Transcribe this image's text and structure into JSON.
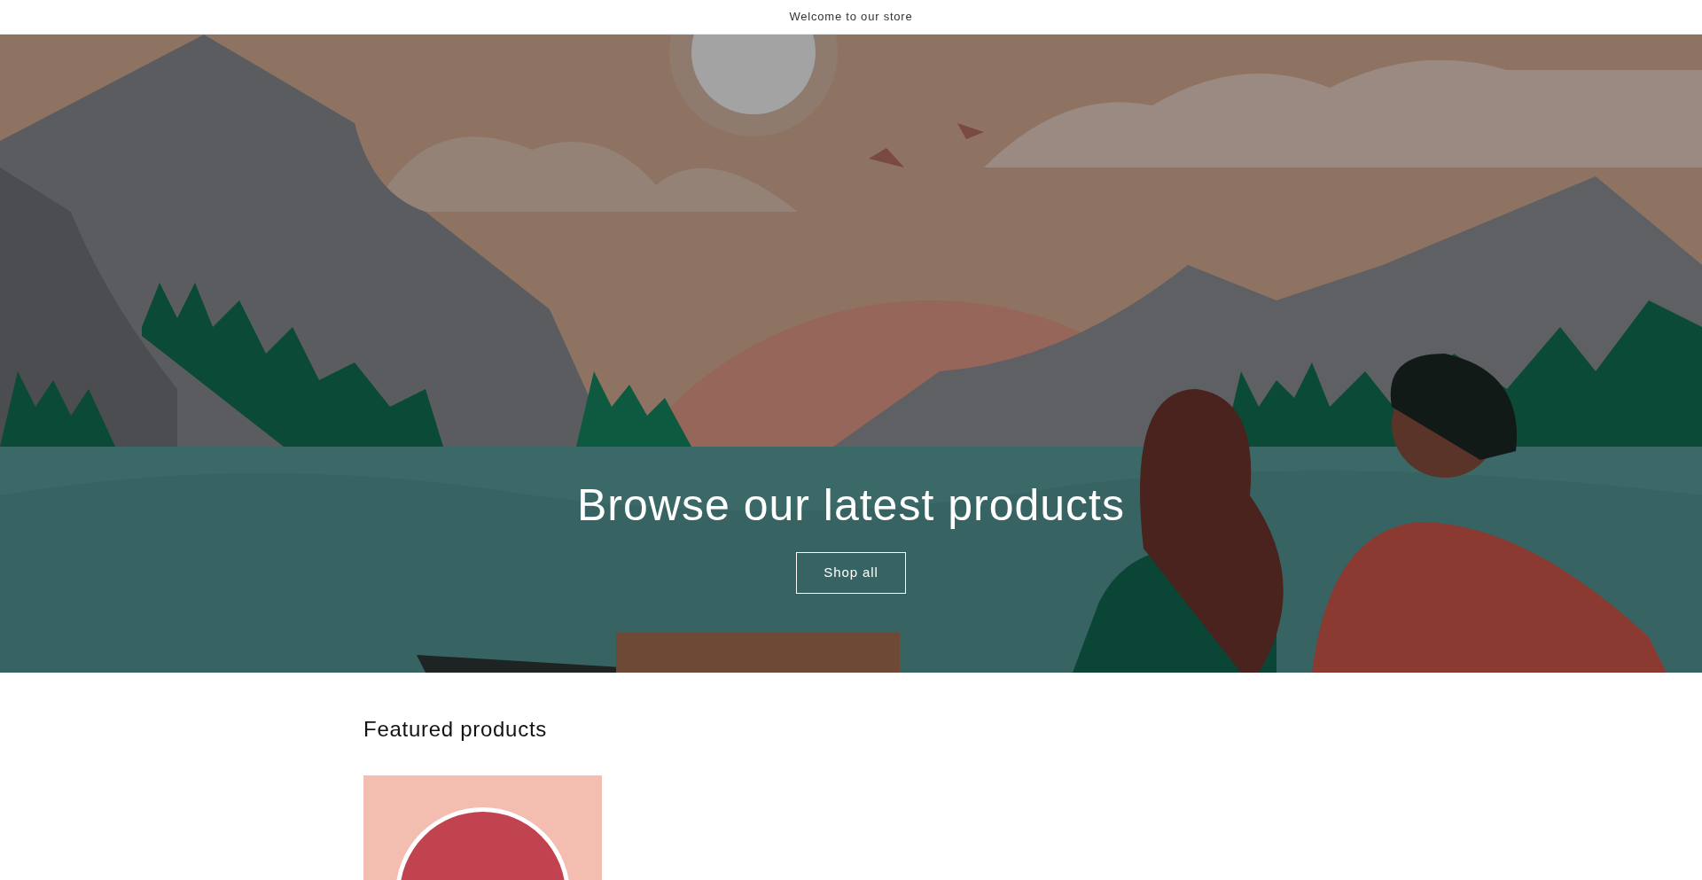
{
  "announcement_bar": {
    "text": "Welcome to our store"
  },
  "hero": {
    "heading": "Browse our latest products",
    "button": "Shop all"
  },
  "featured": {
    "heading": "Featured products"
  }
}
